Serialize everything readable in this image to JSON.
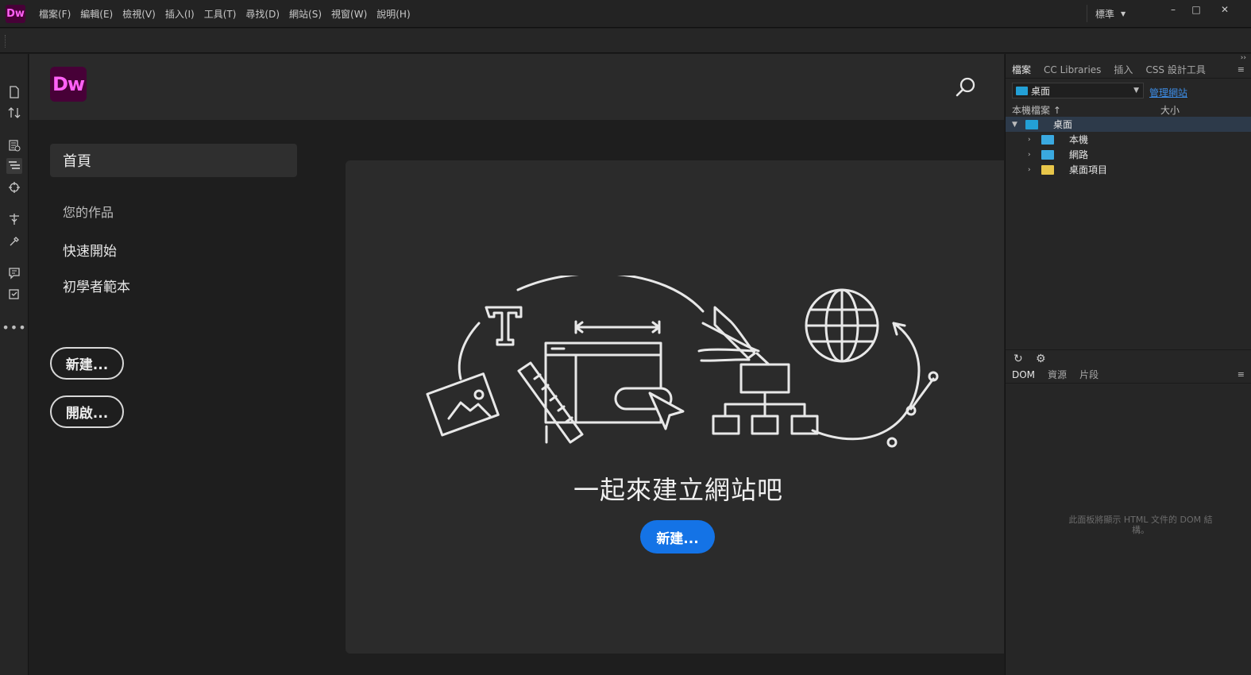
{
  "app": {
    "logo_text": "Dw",
    "menu": [
      "檔案(F)",
      "編輯(E)",
      "檢視(V)",
      "插入(I)",
      "工具(T)",
      "尋找(D)",
      "網站(S)",
      "視窗(W)",
      "說明(H)"
    ],
    "workspace": "標準",
    "window_controls": {
      "minimize": "–",
      "maximize": "□",
      "close": "✕"
    }
  },
  "home": {
    "logo_text": "Dw",
    "nav": {
      "home_label": "首頁",
      "section_label": "您的作品",
      "quick_start": "快速開始",
      "starter_templates": "初學者範本"
    },
    "buttons": {
      "new": "新建...",
      "open": "開啟..."
    },
    "hero": {
      "title": "一起來建立網站吧",
      "button": "新建..."
    }
  },
  "files_panel": {
    "tabs": [
      "檔案",
      "CC Libraries",
      "插入",
      "CSS 設計工具"
    ],
    "site_select": "桌面",
    "manage_link": "管理網站",
    "columns": {
      "local": "本機檔案 ↑",
      "size": "大小"
    },
    "tree": [
      {
        "label": "桌面",
        "expanded": true,
        "selected": true
      },
      {
        "label": "本機",
        "expanded": false
      },
      {
        "label": "網路",
        "expanded": false
      },
      {
        "label": "桌面項目",
        "expanded": false
      }
    ]
  },
  "dom_panel": {
    "tabs": [
      "DOM",
      "資源",
      "片段"
    ],
    "message_line1": "此面板將顯示 HTML 文件的 DOM 結",
    "message_line2": "構。"
  },
  "colors": {
    "brand": "#470137",
    "brand_text": "#ff61f6",
    "accent": "#1473e6",
    "link": "#3d8ee8"
  }
}
